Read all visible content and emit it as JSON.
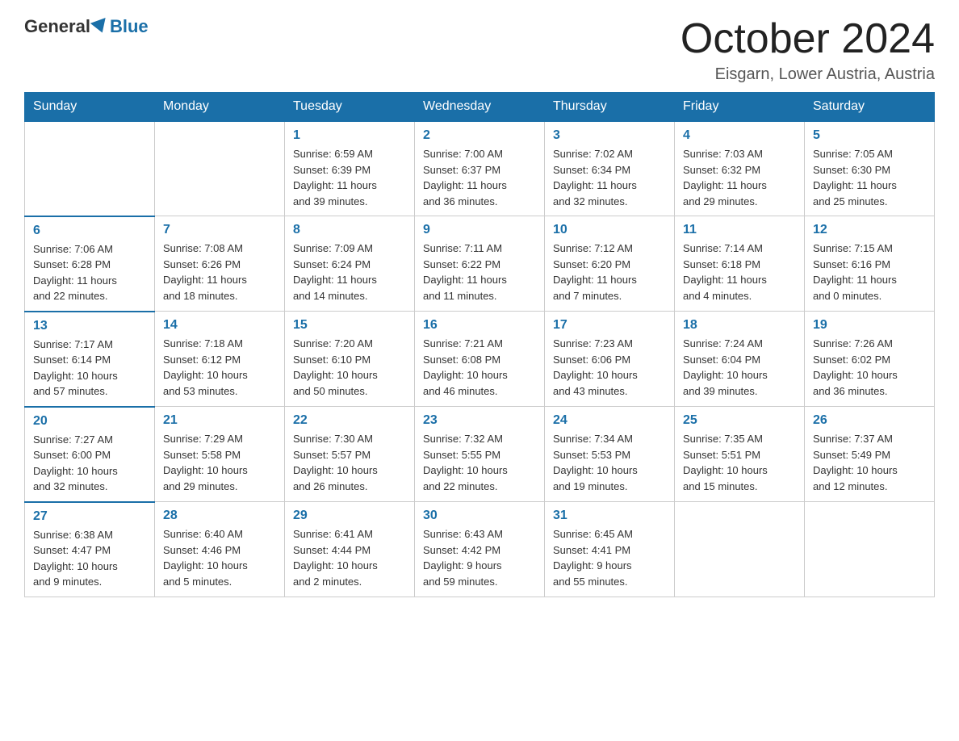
{
  "logo": {
    "general": "General",
    "blue": "Blue"
  },
  "header": {
    "month": "October 2024",
    "location": "Eisgarn, Lower Austria, Austria"
  },
  "days_of_week": [
    "Sunday",
    "Monday",
    "Tuesday",
    "Wednesday",
    "Thursday",
    "Friday",
    "Saturday"
  ],
  "weeks": [
    [
      {
        "day": "",
        "info": ""
      },
      {
        "day": "",
        "info": ""
      },
      {
        "day": "1",
        "info": "Sunrise: 6:59 AM\nSunset: 6:39 PM\nDaylight: 11 hours\nand 39 minutes."
      },
      {
        "day": "2",
        "info": "Sunrise: 7:00 AM\nSunset: 6:37 PM\nDaylight: 11 hours\nand 36 minutes."
      },
      {
        "day": "3",
        "info": "Sunrise: 7:02 AM\nSunset: 6:34 PM\nDaylight: 11 hours\nand 32 minutes."
      },
      {
        "day": "4",
        "info": "Sunrise: 7:03 AM\nSunset: 6:32 PM\nDaylight: 11 hours\nand 29 minutes."
      },
      {
        "day": "5",
        "info": "Sunrise: 7:05 AM\nSunset: 6:30 PM\nDaylight: 11 hours\nand 25 minutes."
      }
    ],
    [
      {
        "day": "6",
        "info": "Sunrise: 7:06 AM\nSunset: 6:28 PM\nDaylight: 11 hours\nand 22 minutes."
      },
      {
        "day": "7",
        "info": "Sunrise: 7:08 AM\nSunset: 6:26 PM\nDaylight: 11 hours\nand 18 minutes."
      },
      {
        "day": "8",
        "info": "Sunrise: 7:09 AM\nSunset: 6:24 PM\nDaylight: 11 hours\nand 14 minutes."
      },
      {
        "day": "9",
        "info": "Sunrise: 7:11 AM\nSunset: 6:22 PM\nDaylight: 11 hours\nand 11 minutes."
      },
      {
        "day": "10",
        "info": "Sunrise: 7:12 AM\nSunset: 6:20 PM\nDaylight: 11 hours\nand 7 minutes."
      },
      {
        "day": "11",
        "info": "Sunrise: 7:14 AM\nSunset: 6:18 PM\nDaylight: 11 hours\nand 4 minutes."
      },
      {
        "day": "12",
        "info": "Sunrise: 7:15 AM\nSunset: 6:16 PM\nDaylight: 11 hours\nand 0 minutes."
      }
    ],
    [
      {
        "day": "13",
        "info": "Sunrise: 7:17 AM\nSunset: 6:14 PM\nDaylight: 10 hours\nand 57 minutes."
      },
      {
        "day": "14",
        "info": "Sunrise: 7:18 AM\nSunset: 6:12 PM\nDaylight: 10 hours\nand 53 minutes."
      },
      {
        "day": "15",
        "info": "Sunrise: 7:20 AM\nSunset: 6:10 PM\nDaylight: 10 hours\nand 50 minutes."
      },
      {
        "day": "16",
        "info": "Sunrise: 7:21 AM\nSunset: 6:08 PM\nDaylight: 10 hours\nand 46 minutes."
      },
      {
        "day": "17",
        "info": "Sunrise: 7:23 AM\nSunset: 6:06 PM\nDaylight: 10 hours\nand 43 minutes."
      },
      {
        "day": "18",
        "info": "Sunrise: 7:24 AM\nSunset: 6:04 PM\nDaylight: 10 hours\nand 39 minutes."
      },
      {
        "day": "19",
        "info": "Sunrise: 7:26 AM\nSunset: 6:02 PM\nDaylight: 10 hours\nand 36 minutes."
      }
    ],
    [
      {
        "day": "20",
        "info": "Sunrise: 7:27 AM\nSunset: 6:00 PM\nDaylight: 10 hours\nand 32 minutes."
      },
      {
        "day": "21",
        "info": "Sunrise: 7:29 AM\nSunset: 5:58 PM\nDaylight: 10 hours\nand 29 minutes."
      },
      {
        "day": "22",
        "info": "Sunrise: 7:30 AM\nSunset: 5:57 PM\nDaylight: 10 hours\nand 26 minutes."
      },
      {
        "day": "23",
        "info": "Sunrise: 7:32 AM\nSunset: 5:55 PM\nDaylight: 10 hours\nand 22 minutes."
      },
      {
        "day": "24",
        "info": "Sunrise: 7:34 AM\nSunset: 5:53 PM\nDaylight: 10 hours\nand 19 minutes."
      },
      {
        "day": "25",
        "info": "Sunrise: 7:35 AM\nSunset: 5:51 PM\nDaylight: 10 hours\nand 15 minutes."
      },
      {
        "day": "26",
        "info": "Sunrise: 7:37 AM\nSunset: 5:49 PM\nDaylight: 10 hours\nand 12 minutes."
      }
    ],
    [
      {
        "day": "27",
        "info": "Sunrise: 6:38 AM\nSunset: 4:47 PM\nDaylight: 10 hours\nand 9 minutes."
      },
      {
        "day": "28",
        "info": "Sunrise: 6:40 AM\nSunset: 4:46 PM\nDaylight: 10 hours\nand 5 minutes."
      },
      {
        "day": "29",
        "info": "Sunrise: 6:41 AM\nSunset: 4:44 PM\nDaylight: 10 hours\nand 2 minutes."
      },
      {
        "day": "30",
        "info": "Sunrise: 6:43 AM\nSunset: 4:42 PM\nDaylight: 9 hours\nand 59 minutes."
      },
      {
        "day": "31",
        "info": "Sunrise: 6:45 AM\nSunset: 4:41 PM\nDaylight: 9 hours\nand 55 minutes."
      },
      {
        "day": "",
        "info": ""
      },
      {
        "day": "",
        "info": ""
      }
    ]
  ]
}
